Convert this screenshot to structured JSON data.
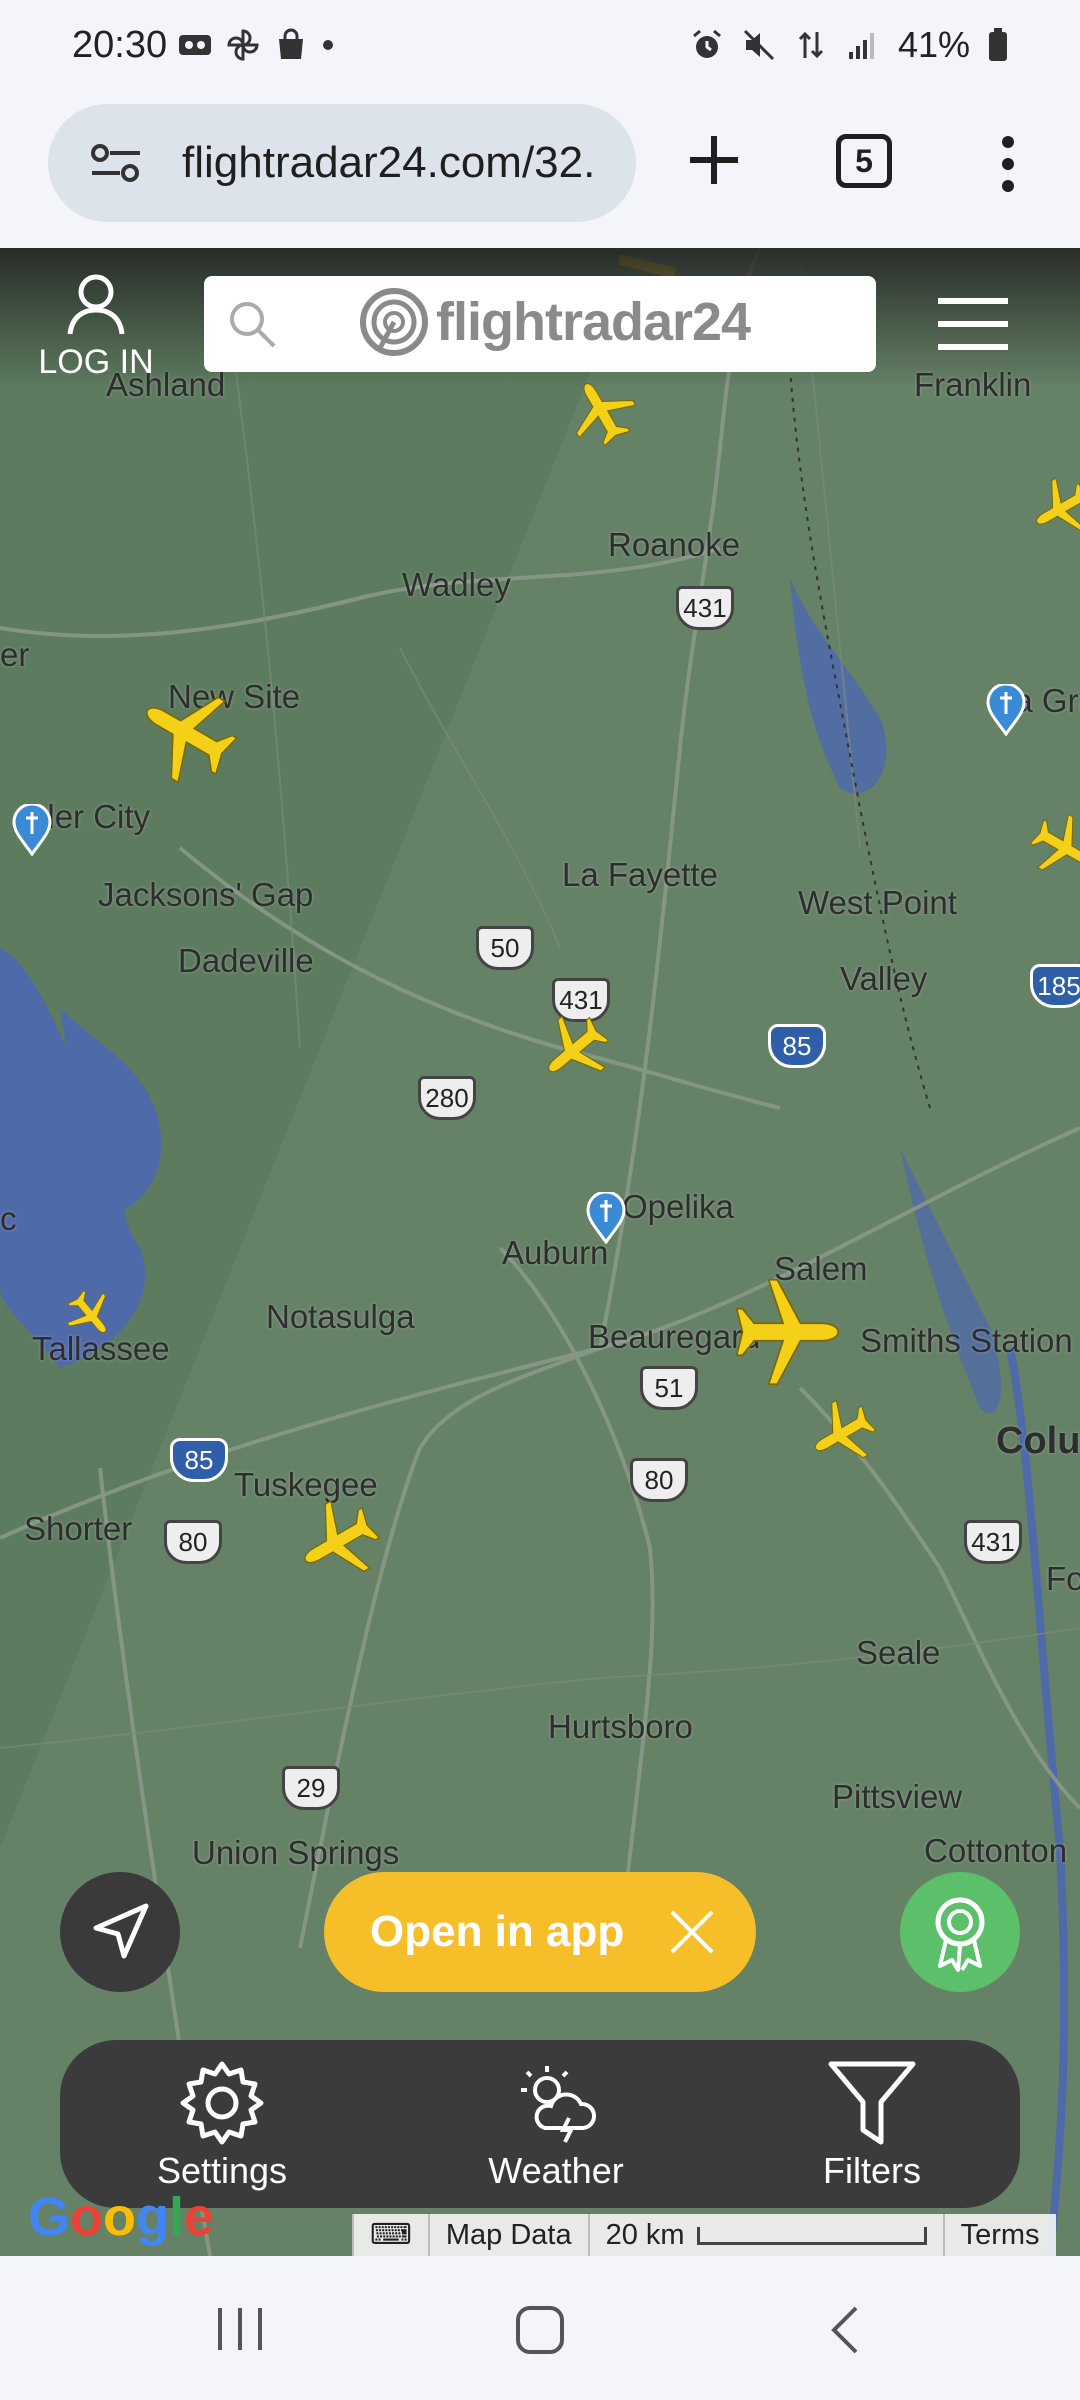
{
  "status_bar": {
    "time": "20:30",
    "battery": "41%"
  },
  "browser": {
    "url": "flightradar24.com/32.",
    "tab_count": "5"
  },
  "header": {
    "login_label": "LOG IN",
    "logo_text": "flightradar24"
  },
  "map": {
    "places": [
      "Ashland",
      "Franklin",
      "Roanoke",
      "Wadley",
      "New Site",
      "La Gran",
      "ader City",
      "Jacksons' Gap",
      "La Fayette",
      "West Point",
      "Dadeville",
      "Valley",
      "Opelika",
      "Auburn",
      "Salem",
      "Notasulga",
      "Tallassee",
      "Beauregard",
      "Smiths Station",
      "Colu",
      "Tuskegee",
      "Shorter",
      "Fo",
      "Seale",
      "Hurtsboro",
      "Pittsview",
      "Union Springs",
      "Cottonton",
      "er",
      "c"
    ],
    "route_shields": [
      "431",
      "50",
      "431",
      "280",
      "51",
      "80",
      "80",
      "29",
      "431"
    ],
    "interstate_shields": [
      "85",
      "85",
      "185"
    ]
  },
  "controls": {
    "open_in_app": "Open in app"
  },
  "toolbar": {
    "settings": "Settings",
    "weather": "Weather",
    "filters": "Filters"
  },
  "map_footer": {
    "google": "Google",
    "map_data": "Map Data",
    "scale": "20 km",
    "terms": "Terms"
  },
  "colors": {
    "accent_yellow": "#f6bf2a",
    "award_green": "#5cc06a",
    "toolbar_bg": "#3b3b3b"
  }
}
